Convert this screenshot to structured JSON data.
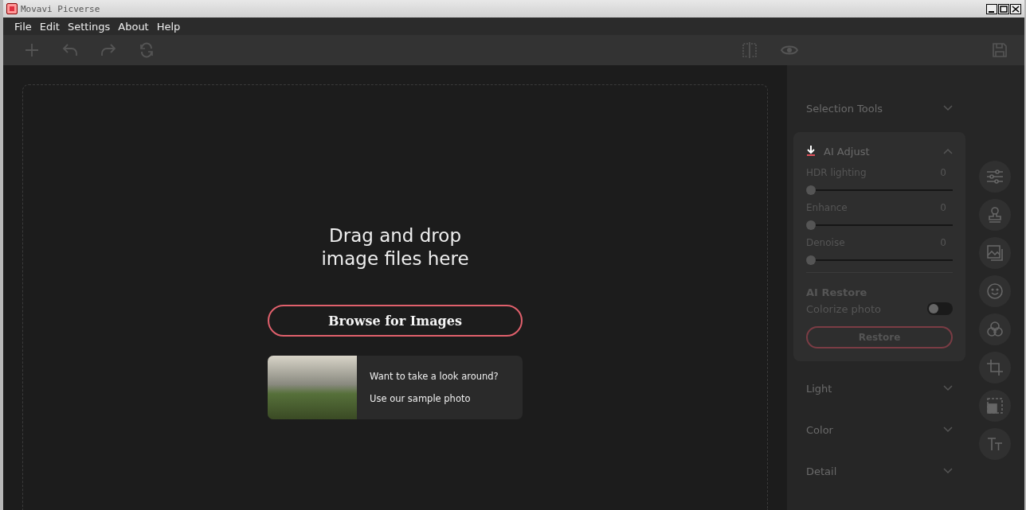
{
  "window": {
    "title": "Movavi Picverse"
  },
  "menu": [
    "File",
    "Edit",
    "Settings",
    "About",
    "Help"
  ],
  "dropzone": {
    "heading": "Drag and drop image files here",
    "button": "Browse for Images",
    "sample": {
      "question": "Want to take a look around?",
      "link": "Use our sample photo"
    }
  },
  "panel": {
    "sections": [
      {
        "kind": "collapsed",
        "title": "Selection Tools",
        "expanded": false
      },
      {
        "kind": "ai",
        "title": "AI Adjust",
        "expanded": true,
        "sliders": [
          {
            "label": "HDR lighting",
            "reading": "0",
            "level": 0
          },
          {
            "label": "Enhance",
            "reading": "0",
            "level": 0
          },
          {
            "label": "Denoise",
            "reading": "0",
            "level": 0
          }
        ],
        "restore": {
          "heading": "AI Restore",
          "toggle_label": "Colorize photo",
          "on": false,
          "button": "Restore"
        }
      },
      {
        "kind": "collapsed",
        "title": "Light",
        "expanded": false
      },
      {
        "kind": "collapsed",
        "title": "Color",
        "expanded": false
      },
      {
        "kind": "collapsed",
        "title": "Detail",
        "expanded": false
      }
    ]
  }
}
